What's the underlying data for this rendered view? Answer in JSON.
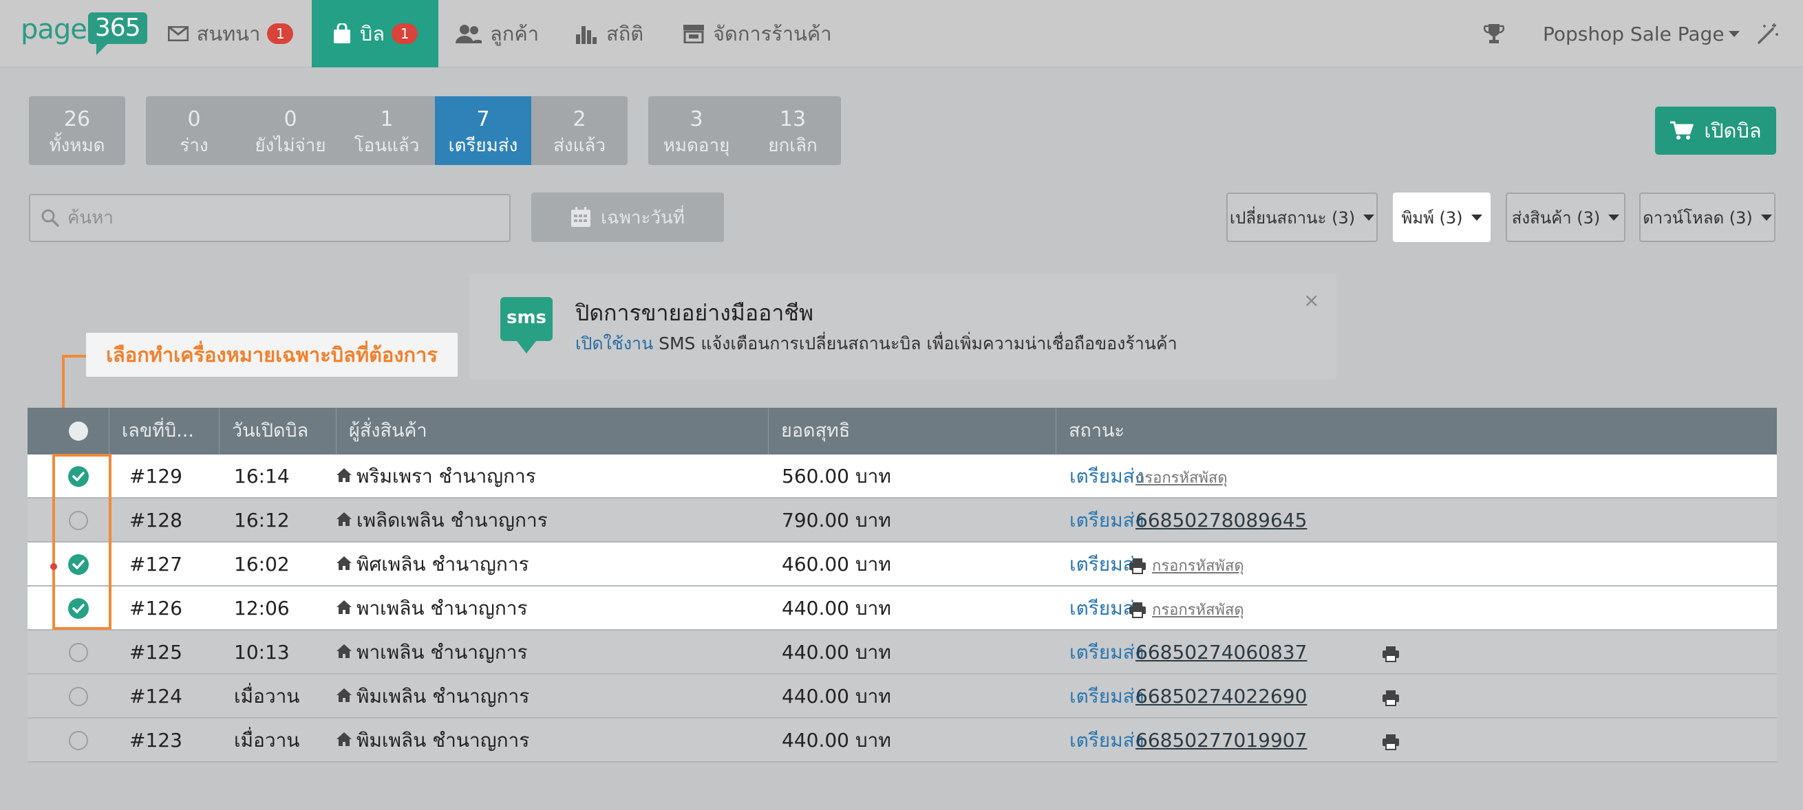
{
  "logo": {
    "text": "page",
    "number": "365"
  },
  "nav": [
    {
      "label": "สนทนา",
      "badge": "1"
    },
    {
      "label": "บิล",
      "badge": "1"
    },
    {
      "label": "ลูกค้า"
    },
    {
      "label": "สถิติ"
    },
    {
      "label": "จัดการร้านค้า"
    }
  ],
  "page_name": "Popshop Sale Page",
  "tabs_all": [
    {
      "num": "26",
      "label": "ทั้งหมด"
    }
  ],
  "tabs_main": [
    {
      "num": "0",
      "label": "ร่าง"
    },
    {
      "num": "0",
      "label": "ยังไม่จ่าย"
    },
    {
      "num": "1",
      "label": "โอนแล้ว"
    },
    {
      "num": "7",
      "label": "เตรียมส่ง"
    },
    {
      "num": "2",
      "label": "ส่งแล้ว"
    }
  ],
  "tabs_other": [
    {
      "num": "3",
      "label": "หมดอายุ"
    },
    {
      "num": "13",
      "label": "ยกเลิก"
    }
  ],
  "open_bill_label": "เปิดบิล",
  "search_placeholder": "ค้นหา",
  "date_filter_label": "เฉพาะวันที่",
  "actions": {
    "change_status": "เปลี่ยนสถานะ (3)",
    "print": "พิมพ์ (3)",
    "ship": "ส่งสินค้า (3)",
    "download": "ดาวน์โหลด (3)"
  },
  "sms": {
    "icon_text": "sms",
    "title": "ปิดการขายอย่างมืออาชีพ",
    "link": "เปิดใช้งาน",
    "subtitle": " SMS แจ้งเตือนการเปลี่ยนสถานะบิล เพื่อเพิ่มความน่าเชื่อถือของร้านค้า",
    "close": "×"
  },
  "callout": "เลือกทำเครื่องหมายเฉพาะบิลที่ต้องการ",
  "columns": {
    "bill_no": "เลขที่บิ...",
    "opened": "วันเปิดบิล",
    "customer": "ผู้สั่งสินค้า",
    "total": "ยอดสุทธิ",
    "status": "สถานะ"
  },
  "rows": [
    {
      "checked": true,
      "bill": "#129",
      "time": "16:14",
      "customer": "พริมเพรา ชำนาญการ",
      "total": "560.00 บาท",
      "status": "เตรียมส่ง",
      "tracking": "กรอกรหัสพัสดุ",
      "tracking_type": "input",
      "printer": "none"
    },
    {
      "checked": false,
      "bill": "#128",
      "time": "16:12",
      "customer": "เพลิดเพลิน ชำนาญการ",
      "total": "790.00 บาท",
      "status": "เตรียมส่ง",
      "tracking": "66850278089645",
      "tracking_type": "number",
      "printer": "none"
    },
    {
      "checked": true,
      "bill": "#127",
      "time": "16:02",
      "customer": "พิศเพลิน ชำนาญการ",
      "total": "460.00 บาท",
      "status": "เตรียมส่ง",
      "tracking": "กรอกรหัสพัสดุ",
      "tracking_type": "input",
      "printer": "before"
    },
    {
      "checked": true,
      "bill": "#126",
      "time": "12:06",
      "customer": "พาเพลิน ชำนาญการ",
      "total": "440.00 บาท",
      "status": "เตรียมส่ง",
      "tracking": "กรอกรหัสพัสดุ",
      "tracking_type": "input",
      "printer": "before"
    },
    {
      "checked": false,
      "bill": "#125",
      "time": "10:13",
      "customer": "พาเพลิน ชำนาญการ",
      "total": "440.00 บาท",
      "status": "เตรียมส่ง",
      "tracking": "66850274060837",
      "tracking_type": "number",
      "printer": "after"
    },
    {
      "checked": false,
      "bill": "#124",
      "time": "เมื่อวาน",
      "customer": "พิมเพลิน ชำนาญการ",
      "total": "440.00 บาท",
      "status": "เตรียมส่ง",
      "tracking": "66850274022690",
      "tracking_type": "number",
      "printer": "after"
    },
    {
      "checked": false,
      "bill": "#123",
      "time": "เมื่อวาน",
      "customer": "พิมเพลิน ชำนาญการ",
      "total": "440.00 บาท",
      "status": "เตรียมส่ง",
      "tracking": "66850277019907",
      "tracking_type": "number",
      "printer": "after"
    }
  ],
  "colors": {
    "brand": "#23a085",
    "active_tab": "#2f82b8",
    "link": "#2a76b0",
    "callout": "#f08a3a"
  }
}
